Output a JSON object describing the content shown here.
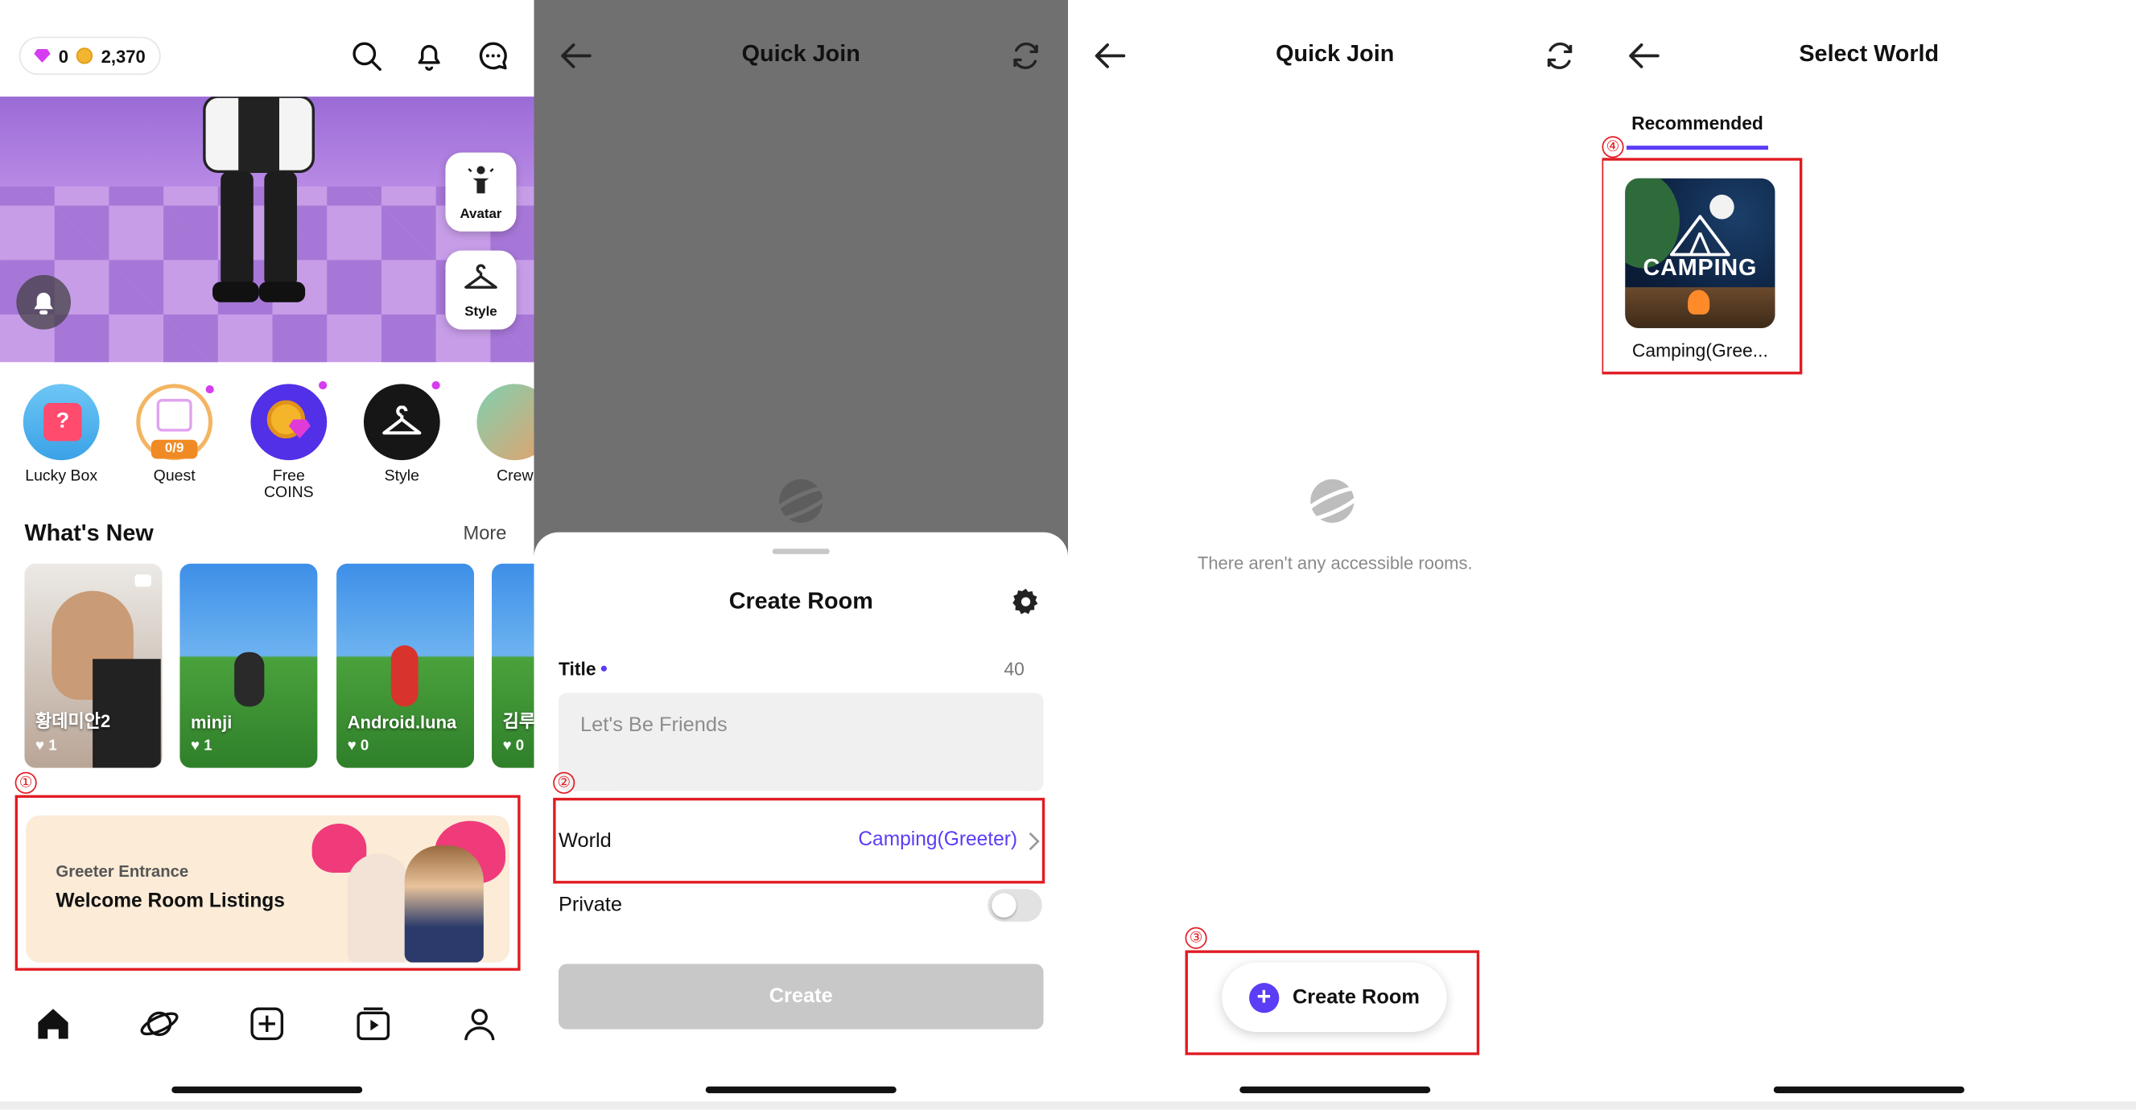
{
  "panel1": {
    "balance": {
      "gems": "0",
      "coins": "2,370"
    },
    "hero_buttons": {
      "avatar": "Avatar",
      "style": "Style"
    },
    "shortcuts": [
      {
        "label": "Lucky Box"
      },
      {
        "label": "Quest",
        "badge": "0/9"
      },
      {
        "label": "Free COINS"
      },
      {
        "label": "Style"
      },
      {
        "label": "Crew"
      }
    ],
    "whats_new": {
      "title": "What's New",
      "more": "More"
    },
    "cards": [
      {
        "name": "황데미안2",
        "likes": "1"
      },
      {
        "name": "minji",
        "likes": "1"
      },
      {
        "name": "Android.luna",
        "likes": "0"
      },
      {
        "name": "김루",
        "likes": "0"
      }
    ],
    "banner": {
      "subtitle": "Greeter Entrance",
      "title": "Welcome Room Listings"
    },
    "annotation": "①"
  },
  "panel2": {
    "header": {
      "title": "Quick Join"
    },
    "sheet": {
      "title": "Create Room",
      "title_label": "Title",
      "title_count": "40",
      "title_placeholder": "Let's Be Friends",
      "world_label": "World",
      "world_value": "Camping(Greeter)",
      "private_label": "Private",
      "create_label": "Create"
    },
    "annotation": "②"
  },
  "panel3": {
    "header": {
      "title": "Quick Join"
    },
    "empty_text": "There aren't any accessible rooms.",
    "create_room_label": "Create Room",
    "annotation": "③"
  },
  "panel4": {
    "header": {
      "title": "Select World"
    },
    "tab": "Recommended",
    "world": {
      "thumb_text": "CAMPING",
      "name": "Camping(Gree..."
    },
    "annotation": "④"
  },
  "colors": {
    "accent": "#5b3df5",
    "annotation": "#e11b22",
    "overlay": "#707070"
  }
}
